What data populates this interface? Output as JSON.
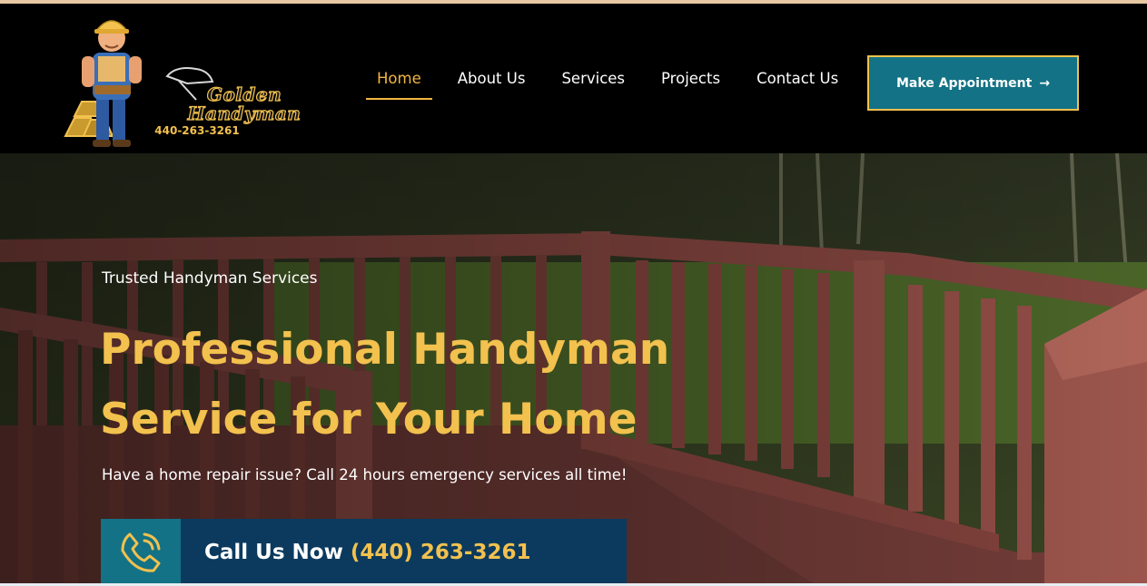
{
  "brand": {
    "logo_word_1": "Golden",
    "logo_word_2": "Handyman",
    "logo_phone": "440-263-3261"
  },
  "nav": {
    "items": [
      {
        "label": "Home",
        "active": true
      },
      {
        "label": "About Us",
        "active": false
      },
      {
        "label": "Services",
        "active": false
      },
      {
        "label": "Projects",
        "active": false
      },
      {
        "label": "Contact Us",
        "active": false
      }
    ],
    "cta_label": "Make Appointment",
    "cta_arrow": "→"
  },
  "hero": {
    "eyebrow": "Trusted Handyman Services",
    "headline_line1": "Professional Handyman",
    "headline_line2": "Service for Your Home",
    "subline": "Have a home repair issue? Call 24 hours emergency services all time!",
    "call_label": "Call Us Now",
    "call_number": "(440) 263-3261"
  },
  "colors": {
    "accent_gold": "#f2c14e",
    "nav_active": "#f3b540",
    "teal": "#137285",
    "navy": "#0b3a5e",
    "header_bg": "#000000"
  },
  "icons": [
    "handyman-mascot-icon",
    "phone-ringing-icon",
    "arrow-right-icon"
  ]
}
